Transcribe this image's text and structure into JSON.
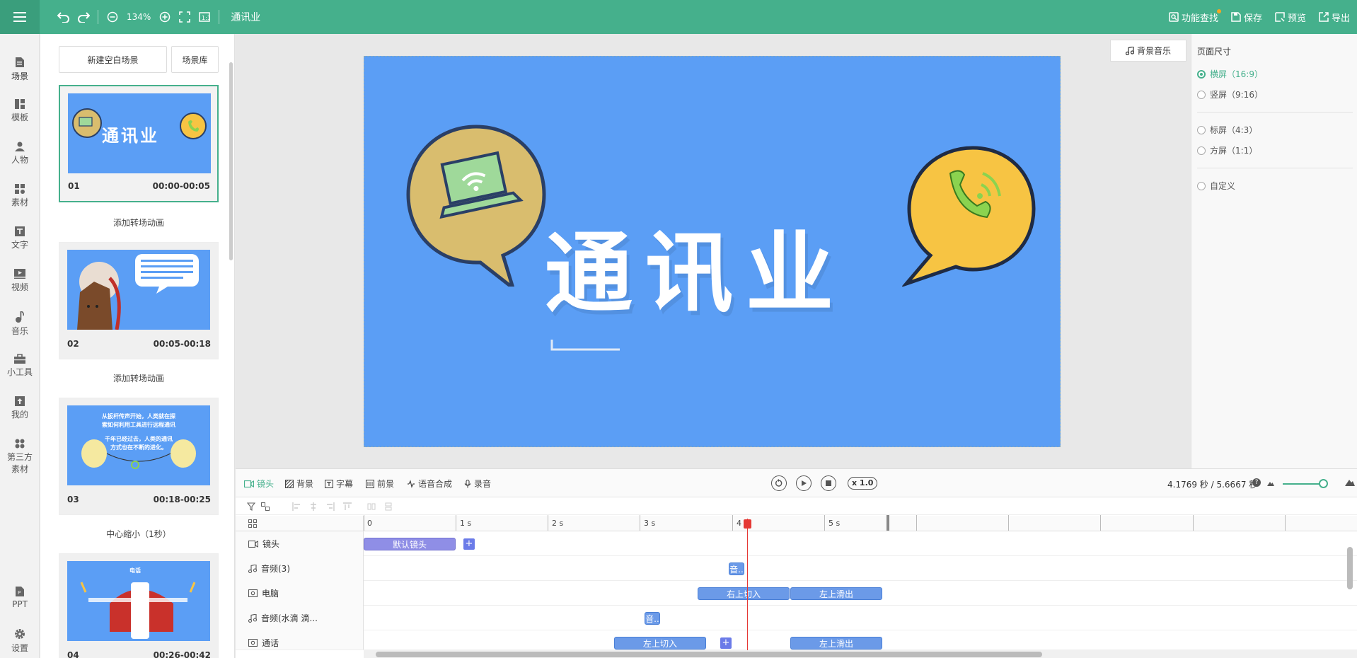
{
  "topbar": {
    "zoom": "134%",
    "title": "通讯业",
    "actions": [
      {
        "label": "功能查找",
        "icon": "search-doc-icon"
      },
      {
        "label": "保存",
        "icon": "save-icon"
      },
      {
        "label": "预览",
        "icon": "preview-icon"
      },
      {
        "label": "导出",
        "icon": "export-icon"
      }
    ],
    "accent": "#45b08c"
  },
  "leftnav": [
    {
      "label": "场景",
      "icon": "scene-icon"
    },
    {
      "label": "模板",
      "icon": "template-icon"
    },
    {
      "label": "人物",
      "icon": "person-icon"
    },
    {
      "label": "素材",
      "icon": "material-icon"
    },
    {
      "label": "文字",
      "icon": "text-icon"
    },
    {
      "label": "视频",
      "icon": "video-icon"
    },
    {
      "label": "音乐",
      "icon": "music-icon"
    },
    {
      "label": "小工具",
      "icon": "toolbox-icon"
    },
    {
      "label": "我的",
      "icon": "upload-icon"
    },
    {
      "label1": "第三方",
      "label2": "素材",
      "icon": "third-party-icon"
    },
    {
      "label": "PPT",
      "icon": "ppt-icon"
    },
    {
      "label": "设置",
      "icon": "gear-icon"
    }
  ],
  "scenes": {
    "new_blank": "新建空白场景",
    "library": "场景库",
    "items": [
      {
        "num": "01",
        "time": "00:00-00:05",
        "thumb_text": "通讯业",
        "transition": "添加转场动画"
      },
      {
        "num": "02",
        "time": "00:05-00:18",
        "transition": "添加转场动画"
      },
      {
        "num": "03",
        "time": "00:18-00:25",
        "thumb_line1": "从扳杆传声开始，人类就在探",
        "thumb_line2": "索如何利用工具进行远程通讯",
        "thumb_line3": "千年已经过去，人类的通讯",
        "thumb_line4": "方式也在不断的进化。",
        "transition": "中心缩小（1秒）"
      },
      {
        "num": "04",
        "time": "00:26-00:42",
        "thumb_top": "电话"
      }
    ]
  },
  "canvas": {
    "bgm_label": "背景音乐",
    "stage_title": "通讯业",
    "stage_bg": "#5b9ef5"
  },
  "page_size": {
    "title": "页面尺寸",
    "options": [
      {
        "label": "横屏（16:9）",
        "selected": true
      },
      {
        "label": "竖屏（9:16）",
        "selected": false
      },
      {
        "label": "标屏（4:3）",
        "selected": false
      },
      {
        "label": "方屏（1:1）",
        "selected": false
      },
      {
        "label": "自定义",
        "selected": false
      }
    ]
  },
  "timeline": {
    "tabs": [
      "镜头",
      "背景",
      "字幕",
      "前景",
      "语音合成",
      "录音"
    ],
    "speed": "x 1.0",
    "time_readout": "4.1769 秒 / 5.6667 秒",
    "ruler": [
      "0",
      "1 s",
      "2 s",
      "3 s",
      "4",
      "5 s"
    ],
    "tracks": [
      {
        "label": "镜头",
        "icon": "camera-icon",
        "clips": [
          {
            "text": "默认镜头"
          }
        ]
      },
      {
        "label": "音频(3)",
        "icon": "music-note-icon",
        "clips": [
          {
            "text": "音.."
          }
        ]
      },
      {
        "label": "电脑",
        "icon": "image-icon",
        "clips": [
          {
            "text": "右上切入"
          },
          {
            "text": "左上滑出"
          }
        ]
      },
      {
        "label": "音频(水滴 滴...",
        "icon": "music-note-icon",
        "clips": [
          {
            "text": "音.."
          }
        ]
      },
      {
        "label": "通话",
        "icon": "image-icon",
        "clips": [
          {
            "text": "左上切入"
          },
          {
            "text": "左上滑出"
          }
        ]
      }
    ]
  }
}
